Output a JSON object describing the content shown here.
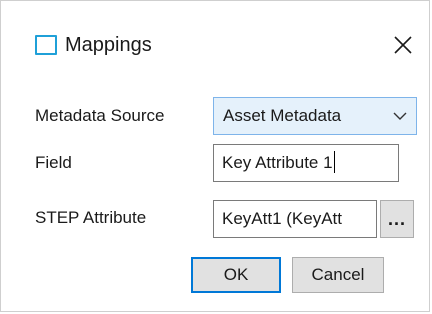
{
  "dialog": {
    "title": "Mappings",
    "icon": "window-icon",
    "close_icon": "close-icon"
  },
  "form": {
    "metadata_source": {
      "label": "Metadata Source",
      "selected": "Asset Metadata"
    },
    "field": {
      "label": "Field",
      "value": "Key Attribute 1"
    },
    "step_attribute": {
      "label": "STEP Attribute",
      "value": "KeyAtt1 (KeyAtt",
      "browse_label": "..."
    }
  },
  "buttons": {
    "ok": "OK",
    "cancel": "Cancel"
  },
  "colors": {
    "accent": "#0078d7",
    "icon": "#1fa0d8",
    "select_bg": "#e5f1fb"
  }
}
